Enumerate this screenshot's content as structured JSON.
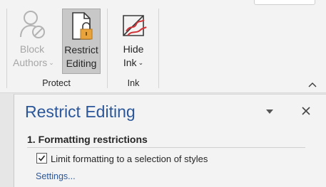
{
  "ribbon": {
    "groups": [
      {
        "label": "Protect",
        "buttons": [
          {
            "line1": "Block",
            "line2": "Authors",
            "icon": "block-authors-icon",
            "enabled": false,
            "dropdown": true
          },
          {
            "line1": "Restrict",
            "line2": "Editing",
            "icon": "restrict-editing-icon",
            "enabled": true,
            "active": true,
            "dropdown": false
          }
        ]
      },
      {
        "label": "Ink",
        "buttons": [
          {
            "line1": "Hide",
            "line2": "Ink",
            "icon": "hide-ink-icon",
            "enabled": true,
            "dropdown": true
          }
        ]
      }
    ],
    "collapse_icon": "chevron-up-icon"
  },
  "pane": {
    "title": "Restrict Editing",
    "menu_icon": "caret-down-icon",
    "close_icon": "close-icon",
    "section_heading": "1. Formatting restrictions",
    "checkbox_label": "Limit formatting to a selection of styles",
    "checkbox_checked": true,
    "settings_link": "Settings..."
  },
  "colors": {
    "accent": "#2b579a",
    "ribbon_bg": "#f3f3f3",
    "active_button_bg": "#c8c8c8",
    "disabled_text": "#a6a6a6",
    "lock_orange": "#e8a33d",
    "ink_red": "#d13438"
  }
}
